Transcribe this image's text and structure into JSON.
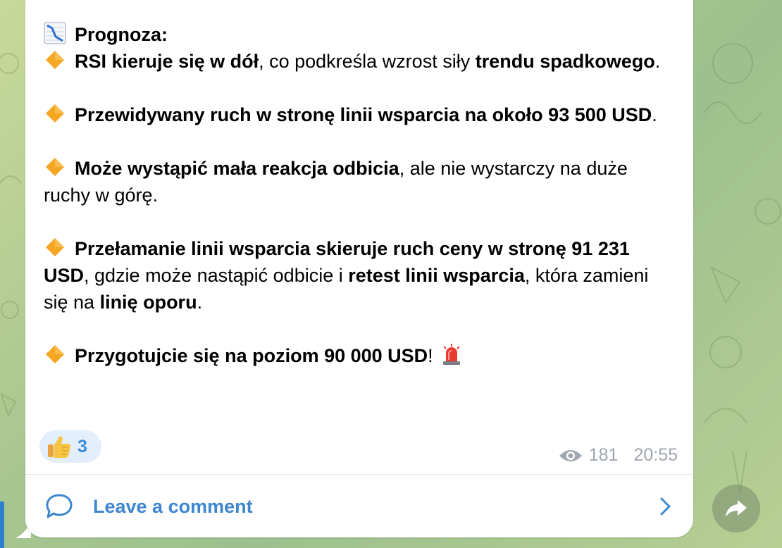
{
  "message": {
    "header_icon": "chart-decreasing-icon",
    "header_title": "Prognoza:",
    "paragraphs": [
      {
        "icon": "orange-diamond-icon",
        "s1": "RSI kieruje się w dół",
        "s2": ", co podkreśla wzrost siły ",
        "s3": "trendu spadkowego",
        "s4": "."
      },
      {
        "icon": "orange-diamond-icon",
        "s1": "Przewidywany ruch w stronę linii wsparcia na około 93 500 USD",
        "s2": "."
      },
      {
        "icon": "orange-diamond-icon",
        "s1": "Może wystąpić mała reakcja odbicia",
        "s2": ", ale nie wystarczy na duże ruchy w górę."
      },
      {
        "icon": "orange-diamond-icon",
        "s1": "Przełamanie linii wsparcia skieruje ruch ceny w stronę 91 231 USD",
        "s2": ", gdzie może nastąpić odbicie i ",
        "s3": "retest linii wsparcia",
        "s4": ", która zamieni się na ",
        "s5": "linię oporu",
        "s6": "."
      },
      {
        "icon": "orange-diamond-icon",
        "s1": "Przygotujcie się na poziom 90 000 USD",
        "s2": "!",
        "trail_icon": "police-light-icon"
      }
    ]
  },
  "reaction": {
    "emoji": "thumbs-up-icon",
    "count": "3"
  },
  "meta": {
    "views_icon": "eye-icon",
    "views": "181",
    "time": "20:55"
  },
  "comments": {
    "label": "Leave a comment",
    "icon": "comment-bubble-icon",
    "chevron": "chevron-right-icon"
  },
  "share": {
    "icon": "share-arrow-icon"
  },
  "colors": {
    "accent": "#3d86d0",
    "reaction_bg": "#e3eefc",
    "meta_text": "#a0a7ae",
    "diamond": "#f5a623"
  }
}
